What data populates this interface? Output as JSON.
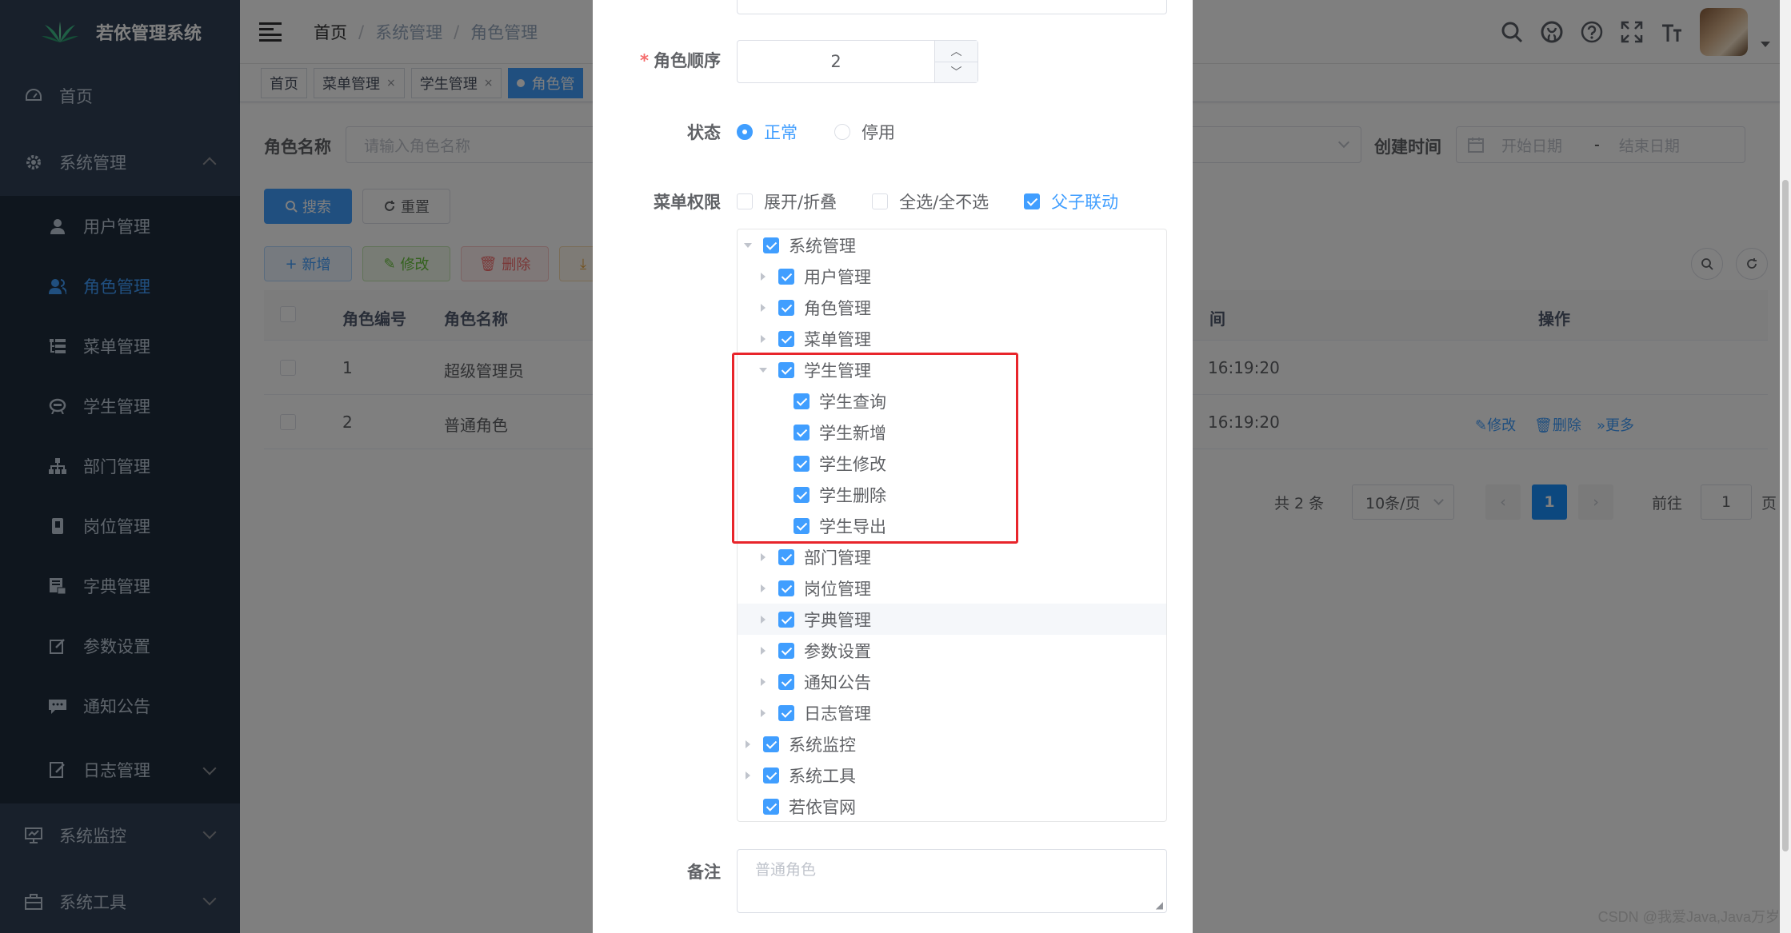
{
  "app": {
    "title": "若依管理系统"
  },
  "sidebar": {
    "items": [
      {
        "label": "首页",
        "icon": "dashboard-icon"
      },
      {
        "label": "系统管理",
        "icon": "gear-icon",
        "expanded": true
      },
      {
        "label": "用户管理",
        "icon": "user-icon"
      },
      {
        "label": "角色管理",
        "icon": "peoples-icon",
        "active": true
      },
      {
        "label": "菜单管理",
        "icon": "tree-table-icon"
      },
      {
        "label": "学生管理",
        "icon": "robot-icon"
      },
      {
        "label": "部门管理",
        "icon": "tree-icon"
      },
      {
        "label": "岗位管理",
        "icon": "post-icon"
      },
      {
        "label": "字典管理",
        "icon": "dict-icon"
      },
      {
        "label": "参数设置",
        "icon": "edit-icon"
      },
      {
        "label": "通知公告",
        "icon": "message-icon"
      },
      {
        "label": "日志管理",
        "icon": "log-icon"
      },
      {
        "label": "系统监控",
        "icon": "monitor-icon"
      },
      {
        "label": "系统工具",
        "icon": "tool-icon"
      }
    ]
  },
  "navbar": {
    "breadcrumb": [
      "首页",
      "系统管理",
      "角色管理"
    ],
    "icons": [
      "search-icon",
      "github-icon",
      "question-icon",
      "fullscreen-icon",
      "font-size-icon"
    ]
  },
  "tags": [
    {
      "label": "首页"
    },
    {
      "label": "菜单管理",
      "closable": true
    },
    {
      "label": "学生管理",
      "closable": true
    },
    {
      "label": "角色管",
      "active": true
    }
  ],
  "search": {
    "role_name_label": "角色名称",
    "role_name_placeholder": "请输入角色名称",
    "create_time_label": "创建时间",
    "start_placeholder": "开始日期",
    "range_sep": "-",
    "end_placeholder": "结束日期",
    "search_btn": "搜索",
    "reset_btn": "重置"
  },
  "toolbar": {
    "add": "新增",
    "edit": "修改",
    "delete": "删除"
  },
  "table": {
    "headers": [
      "角色编号",
      "角色名称",
      "间",
      "操作"
    ],
    "rows": [
      {
        "id": "1",
        "name": "超级管理员",
        "time": "16:19:20"
      },
      {
        "id": "2",
        "name": "普通角色",
        "time": "16:19:20",
        "actions": [
          "修改",
          "删除",
          "更多"
        ]
      }
    ]
  },
  "pagination": {
    "total": "共 2 条",
    "page_size": "10条/页",
    "current": "1",
    "goto_prefix": "前往",
    "goto_value": "1",
    "goto_suffix": "页"
  },
  "dialog": {
    "order_label": "角色顺序",
    "order_value": "2",
    "status_label": "状态",
    "status_options": [
      {
        "label": "正常",
        "checked": true
      },
      {
        "label": "停用",
        "checked": false
      }
    ],
    "menu_label": "菜单权限",
    "menu_opts": [
      {
        "label": "展开/折叠",
        "checked": false
      },
      {
        "label": "全选/全不选",
        "checked": false
      },
      {
        "label": "父子联动",
        "checked": true
      }
    ],
    "tree": [
      {
        "label": "系统管理",
        "level": 0,
        "arrow": "down"
      },
      {
        "label": "用户管理",
        "level": 1,
        "arrow": "right"
      },
      {
        "label": "角色管理",
        "level": 1,
        "arrow": "right"
      },
      {
        "label": "菜单管理",
        "level": 1,
        "arrow": "right"
      },
      {
        "label": "学生管理",
        "level": 1,
        "arrow": "down"
      },
      {
        "label": "学生查询",
        "level": 2,
        "arrow": "none"
      },
      {
        "label": "学生新增",
        "level": 2,
        "arrow": "none"
      },
      {
        "label": "学生修改",
        "level": 2,
        "arrow": "none"
      },
      {
        "label": "学生删除",
        "level": 2,
        "arrow": "none"
      },
      {
        "label": "学生导出",
        "level": 2,
        "arrow": "none"
      },
      {
        "label": "部门管理",
        "level": 1,
        "arrow": "right"
      },
      {
        "label": "岗位管理",
        "level": 1,
        "arrow": "right"
      },
      {
        "label": "字典管理",
        "level": 1,
        "arrow": "right",
        "hover": true
      },
      {
        "label": "参数设置",
        "level": 1,
        "arrow": "right"
      },
      {
        "label": "通知公告",
        "level": 1,
        "arrow": "right"
      },
      {
        "label": "日志管理",
        "level": 1,
        "arrow": "right"
      },
      {
        "label": "系统监控",
        "level": 0,
        "arrow": "right"
      },
      {
        "label": "系统工具",
        "level": 0,
        "arrow": "right"
      },
      {
        "label": "若依官网",
        "level": 0,
        "arrow": "none"
      }
    ],
    "remark_label": "备注",
    "remark_placeholder": "普通角色"
  },
  "watermark": "CSDN @我爱Java,Java万岁",
  "colors": {
    "sidebar": "#304156",
    "submenu": "#1f2d3d",
    "primary": "#409eff",
    "highlight_border": "#e8252b"
  }
}
